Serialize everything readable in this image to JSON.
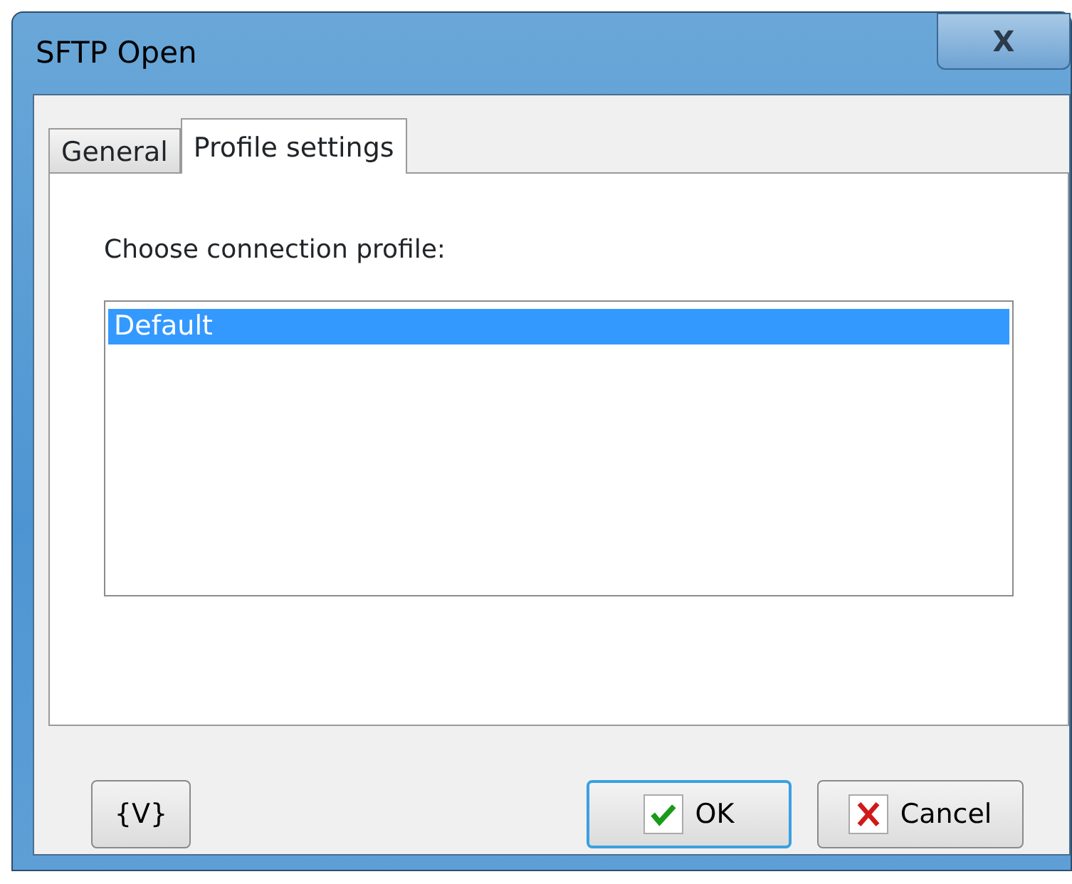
{
  "window": {
    "title": "SFTP Open",
    "close_glyph": "X"
  },
  "tabs": [
    {
      "label": "General",
      "selected": false
    },
    {
      "label": "Profile settings",
      "selected": true
    }
  ],
  "prompt": "Choose connection profile:",
  "profiles": [
    {
      "label": "Default",
      "selected": true
    }
  ],
  "buttons": [
    {
      "kind": "variables",
      "label": "{V}"
    },
    {
      "kind": "ok",
      "label": "OK",
      "focused": true
    },
    {
      "kind": "cancel",
      "label": "Cancel",
      "focused": false
    }
  ]
}
